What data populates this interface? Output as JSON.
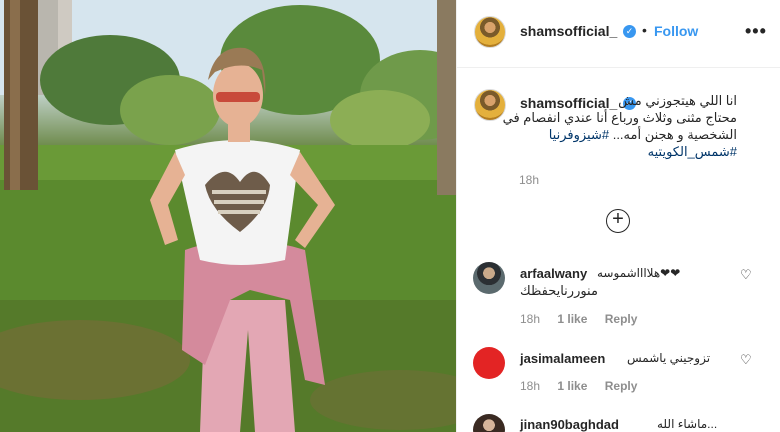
{
  "post": {
    "username": "shamsofficial_",
    "follow_label": "Follow",
    "separator": "•",
    "more_icon": "•••",
    "caption_line1": "انا اللي هيتجوزني مش",
    "caption_line2": "محتاج مثنى وثلاث ورباع أنا عندي انفصام في",
    "caption_line3": "الشخصية و هجنن أمه...",
    "caption_tag1": "#شيزوفرنيا",
    "caption_tag2": "#شمس_الكويتيه",
    "caption_time": "18h",
    "load_more_icon": "+"
  },
  "comments": [
    {
      "username": "arfaalwany",
      "text_line1": "هلااااشموسه❤❤",
      "text_line2": "منوررنايحفظك",
      "time": "18h",
      "likes": "1 like",
      "reply": "Reply",
      "avatar_color": "#5b6a6e"
    },
    {
      "username": "jasimalameen",
      "text_line1": "تزوجيني ياشمس",
      "time": "18h",
      "likes": "1 like",
      "reply": "Reply",
      "avatar_color": "#e32424"
    },
    {
      "username": "jinan90baghdad",
      "text_line1": "...ماشاء الله"
    }
  ],
  "icons": {
    "heart": "♡",
    "verified": "✓"
  }
}
